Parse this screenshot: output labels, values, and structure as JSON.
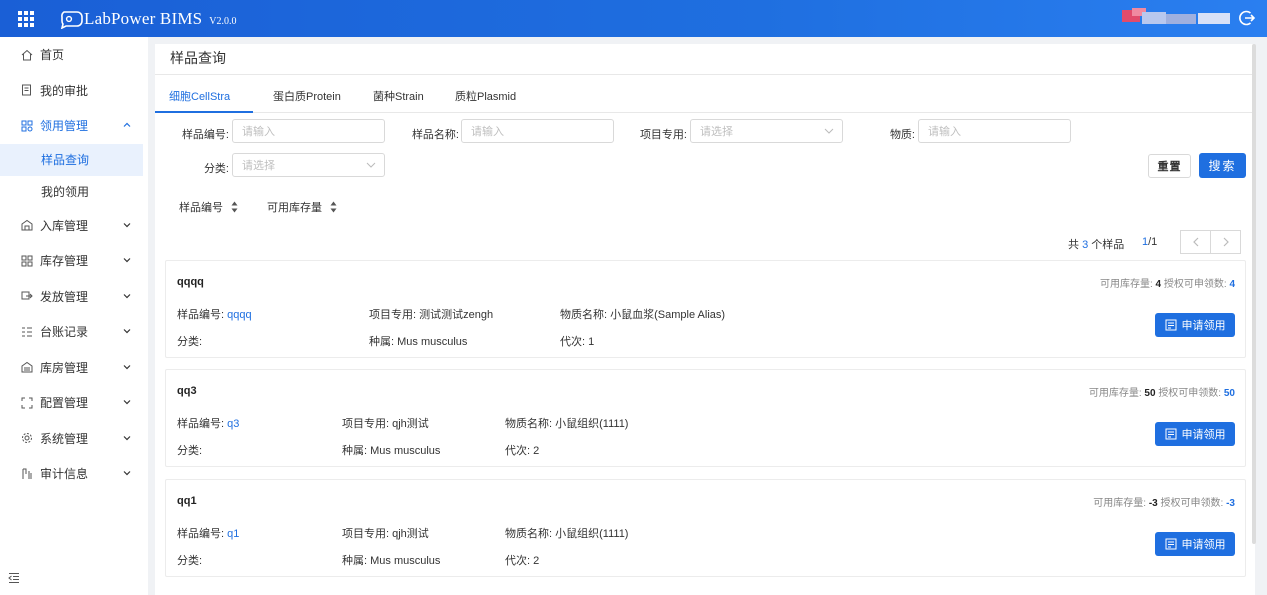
{
  "header": {
    "logo_text": "LabPower BIMS",
    "version": "V2.0.0",
    "user_blur_colors": [
      "#e14b6b",
      "#b8c8ee",
      "#9fb0df",
      "#d8e1f7"
    ]
  },
  "sidebar": {
    "items": [
      {
        "label": "首页",
        "icon": "home-icon"
      },
      {
        "label": "我的审批",
        "icon": "approval-icon"
      },
      {
        "label": "领用管理",
        "icon": "requisition-icon",
        "expanded": true
      },
      {
        "label": "入库管理",
        "icon": "inbound-icon"
      },
      {
        "label": "库存管理",
        "icon": "inventory-icon"
      },
      {
        "label": "发放管理",
        "icon": "distribution-icon"
      },
      {
        "label": "台账记录",
        "icon": "ledger-icon"
      },
      {
        "label": "库房管理",
        "icon": "warehouse-icon"
      },
      {
        "label": "配置管理",
        "icon": "config-icon"
      },
      {
        "label": "系统管理",
        "icon": "system-icon"
      },
      {
        "label": "审计信息",
        "icon": "audit-icon"
      }
    ],
    "sub_items": [
      "样品查询",
      "我的领用"
    ]
  },
  "main": {
    "title": "样品查询",
    "tabs": [
      "细胞CellStra",
      "蛋白质Protein",
      "菌种Strain",
      "质粒Plasmid"
    ],
    "filters": {
      "sample_no_label": "样品编号:",
      "sample_no_placeholder": "请输入",
      "sample_name_label": "样品名称:",
      "sample_name_placeholder": "请输入",
      "project_label": "项目专用:",
      "project_placeholder": "请选择",
      "material_label": "物质:",
      "material_placeholder": "请输入",
      "category_label": "分类:",
      "category_placeholder": "请选择"
    },
    "reset_label": "重置",
    "search_label": "搜索",
    "sort": [
      "样品编号",
      "可用库存量"
    ],
    "summary": {
      "prefix": "共",
      "count": "3",
      "suffix": "个样品",
      "page": "1",
      "total_pages": "/1"
    },
    "cards": [
      {
        "name": "qqqq",
        "stock_label": "可用库存量:",
        "stock": "4",
        "auth_label": "授权可申领数:",
        "auth": "4",
        "sample_no_label": "样品编号:",
        "sample_no": "qqqq",
        "project_label": "项目专用:",
        "project": "测试测试zengh",
        "material_label": "物质名称:",
        "material": "小鼠血浆(Sample Alias)",
        "category_label": "分类:",
        "species_label": "种属:",
        "species": "Mus musculus",
        "gen_label": "代次:",
        "gen": "1",
        "button": "申请领用"
      },
      {
        "name": "qq3",
        "stock_label": "可用库存量:",
        "stock": "50",
        "auth_label": "授权可申领数:",
        "auth": "50",
        "sample_no_label": "样品编号:",
        "sample_no": "q3",
        "project_label": "项目专用:",
        "project": "qjh测试",
        "material_label": "物质名称:",
        "material": "小鼠组织(1111)",
        "category_label": "分类:",
        "species_label": "种属:",
        "species": "Mus musculus",
        "gen_label": "代次:",
        "gen": "2",
        "button": "申请领用"
      },
      {
        "name": "qq1",
        "stock_label": "可用库存量:",
        "stock": "-3",
        "auth_label": "授权可申领数:",
        "auth": "-3",
        "sample_no_label": "样品编号:",
        "sample_no": "q1",
        "project_label": "项目专用:",
        "project": "qjh测试",
        "material_label": "物质名称:",
        "material": "小鼠组织(1111)",
        "category_label": "分类:",
        "species_label": "种属:",
        "species": "Mus musculus",
        "gen_label": "代次:",
        "gen": "2",
        "button": "申请领用"
      }
    ]
  },
  "colors": {
    "accent": "#1f6fe0",
    "header": "#1a5fd6",
    "selected_bg": "#e9f1fd"
  }
}
